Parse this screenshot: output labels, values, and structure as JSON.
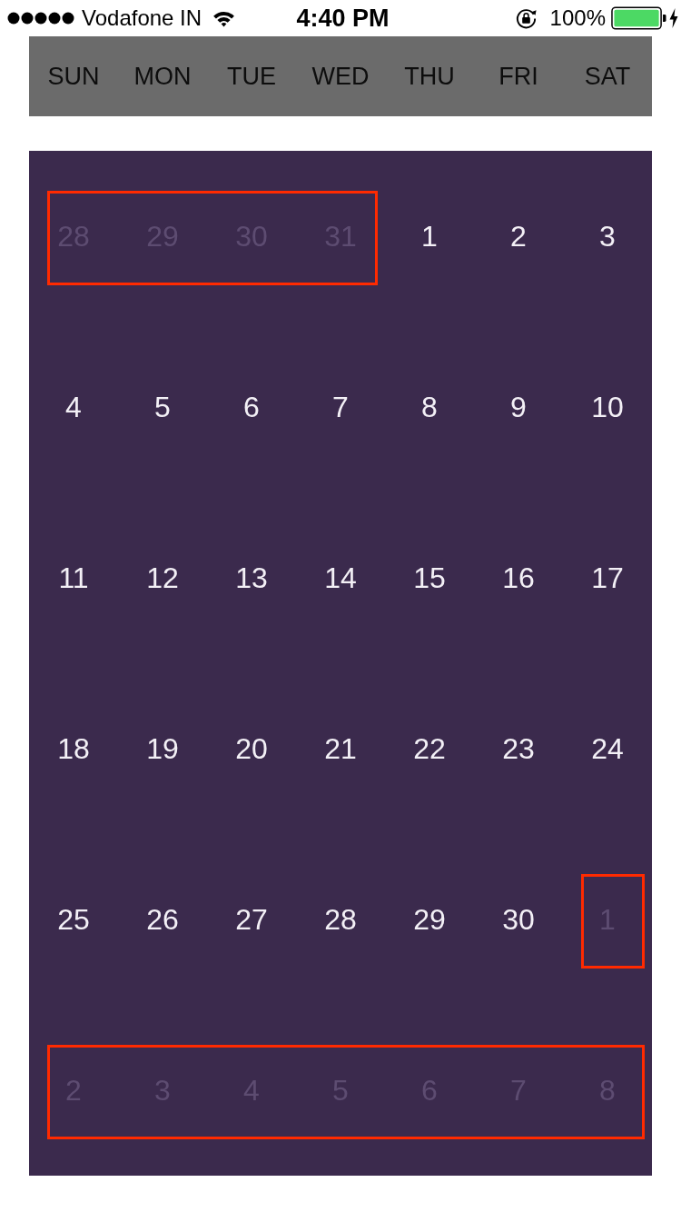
{
  "status_bar": {
    "carrier": "Vodafone IN",
    "time": "4:40 PM",
    "battery": "100%"
  },
  "weekdays": [
    "SUN",
    "MON",
    "TUE",
    "WED",
    "THU",
    "FRI",
    "SAT"
  ],
  "weeks": [
    {
      "groups": [
        {
          "outlined": true,
          "days": [
            {
              "label": "28",
              "dimmed": true
            },
            {
              "label": "29",
              "dimmed": true
            },
            {
              "label": "30",
              "dimmed": true
            },
            {
              "label": "31",
              "dimmed": true
            }
          ]
        },
        {
          "outlined": false,
          "days": [
            {
              "label": "1",
              "dimmed": false
            },
            {
              "label": "2",
              "dimmed": false
            },
            {
              "label": "3",
              "dimmed": false
            }
          ]
        }
      ]
    },
    {
      "groups": [
        {
          "outlined": false,
          "days": [
            {
              "label": "4",
              "dimmed": false
            },
            {
              "label": "5",
              "dimmed": false
            },
            {
              "label": "6",
              "dimmed": false
            },
            {
              "label": "7",
              "dimmed": false
            },
            {
              "label": "8",
              "dimmed": false
            },
            {
              "label": "9",
              "dimmed": false
            },
            {
              "label": "10",
              "dimmed": false
            }
          ]
        }
      ]
    },
    {
      "groups": [
        {
          "outlined": false,
          "days": [
            {
              "label": "11",
              "dimmed": false
            },
            {
              "label": "12",
              "dimmed": false
            },
            {
              "label": "13",
              "dimmed": false
            },
            {
              "label": "14",
              "dimmed": false
            },
            {
              "label": "15",
              "dimmed": false
            },
            {
              "label": "16",
              "dimmed": false
            },
            {
              "label": "17",
              "dimmed": false
            }
          ]
        }
      ]
    },
    {
      "groups": [
        {
          "outlined": false,
          "days": [
            {
              "label": "18",
              "dimmed": false
            },
            {
              "label": "19",
              "dimmed": false
            },
            {
              "label": "20",
              "dimmed": false
            },
            {
              "label": "21",
              "dimmed": false
            },
            {
              "label": "22",
              "dimmed": false
            },
            {
              "label": "23",
              "dimmed": false
            },
            {
              "label": "24",
              "dimmed": false
            }
          ]
        }
      ]
    },
    {
      "groups": [
        {
          "outlined": false,
          "days": [
            {
              "label": "25",
              "dimmed": false
            },
            {
              "label": "26",
              "dimmed": false
            },
            {
              "label": "27",
              "dimmed": false
            },
            {
              "label": "28",
              "dimmed": false
            },
            {
              "label": "29",
              "dimmed": false
            },
            {
              "label": "30",
              "dimmed": false
            }
          ]
        },
        {
          "outlined": true,
          "days": [
            {
              "label": "1",
              "dimmed": true
            }
          ]
        }
      ]
    },
    {
      "groups": [
        {
          "outlined": true,
          "days": [
            {
              "label": "2",
              "dimmed": true
            },
            {
              "label": "3",
              "dimmed": true
            },
            {
              "label": "4",
              "dimmed": true
            },
            {
              "label": "5",
              "dimmed": true
            },
            {
              "label": "6",
              "dimmed": true
            },
            {
              "label": "7",
              "dimmed": true
            },
            {
              "label": "8",
              "dimmed": true
            }
          ]
        }
      ]
    }
  ]
}
